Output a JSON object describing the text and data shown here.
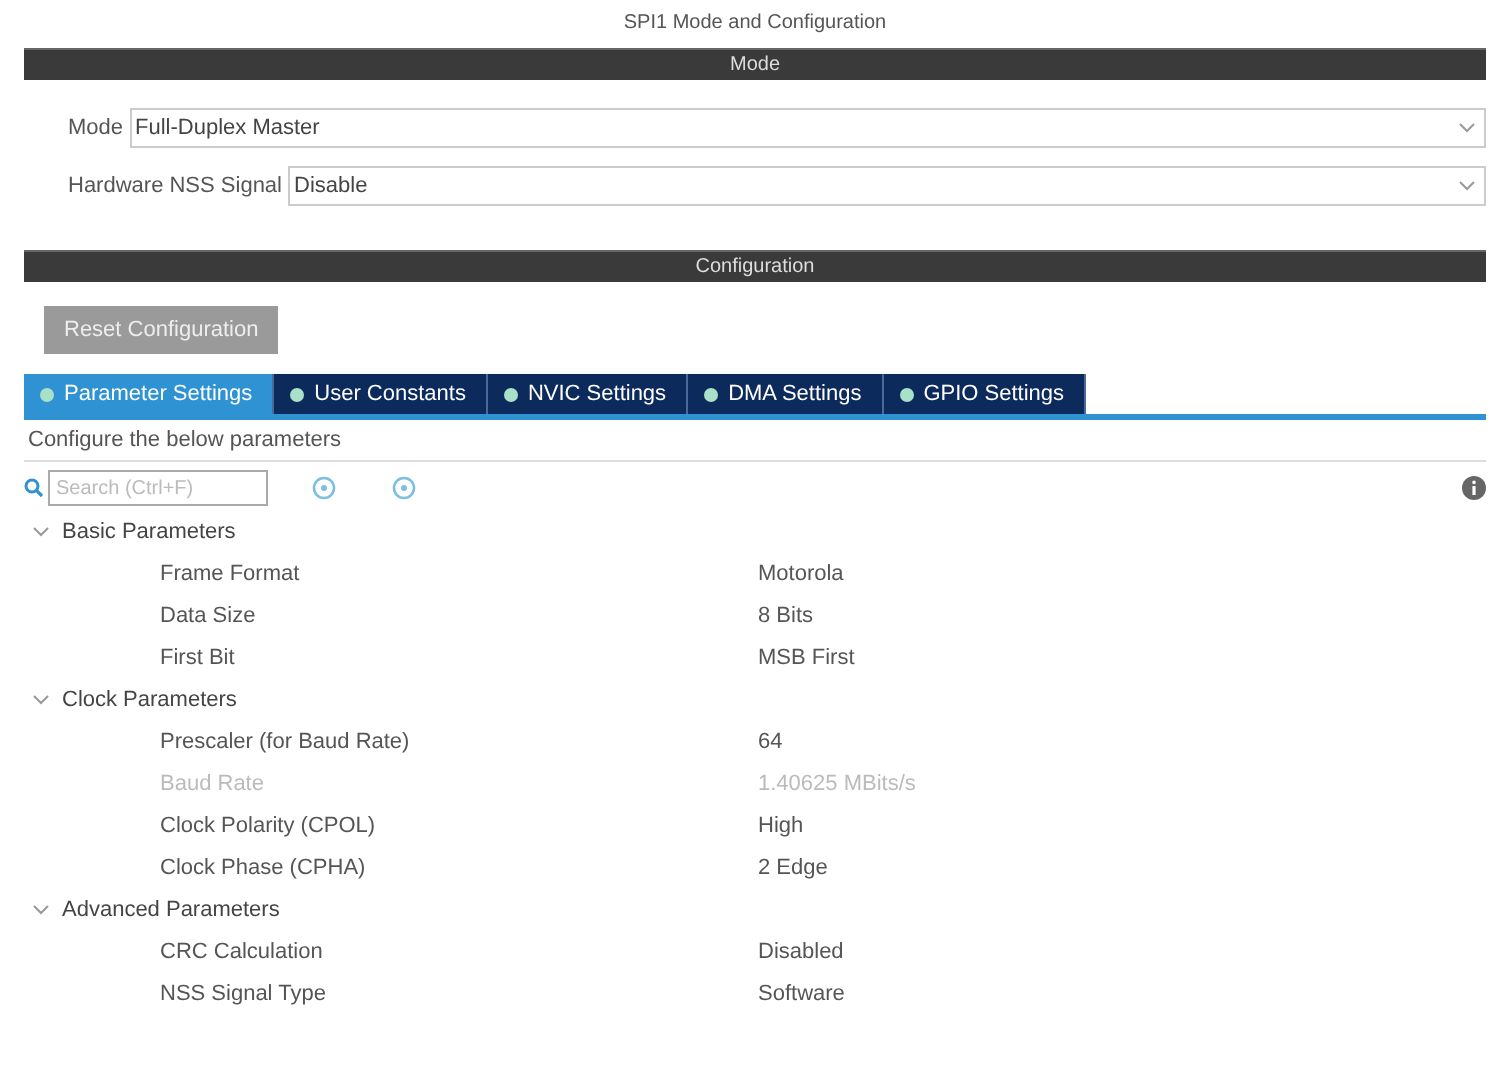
{
  "title": "SPI1 Mode and Configuration",
  "mode_section": {
    "header": "Mode",
    "fields": [
      {
        "label": "Mode",
        "value": "Full-Duplex Master"
      },
      {
        "label": "Hardware NSS Signal",
        "value": "Disable"
      }
    ]
  },
  "config_section": {
    "header": "Configuration",
    "reset_button": "Reset Configuration",
    "tabs": [
      {
        "label": "Parameter Settings",
        "selected": true
      },
      {
        "label": "User Constants",
        "selected": false
      },
      {
        "label": "NVIC Settings",
        "selected": false
      },
      {
        "label": "DMA Settings",
        "selected": false
      },
      {
        "label": "GPIO Settings",
        "selected": false
      }
    ],
    "hint": "Configure the below parameters",
    "search": {
      "placeholder": "Search (Ctrl+F)"
    },
    "groups": [
      {
        "name": "Basic Parameters",
        "expanded": true,
        "children": [
          {
            "name": "Frame Format",
            "value": "Motorola",
            "disabled": false
          },
          {
            "name": "Data Size",
            "value": "8 Bits",
            "disabled": false
          },
          {
            "name": "First Bit",
            "value": "MSB First",
            "disabled": false
          }
        ]
      },
      {
        "name": "Clock Parameters",
        "expanded": true,
        "children": [
          {
            "name": "Prescaler (for Baud Rate)",
            "value": "64",
            "disabled": false
          },
          {
            "name": "Baud Rate",
            "value": "1.40625 MBits/s",
            "disabled": true
          },
          {
            "name": "Clock Polarity (CPOL)",
            "value": "High",
            "disabled": false
          },
          {
            "name": "Clock Phase (CPHA)",
            "value": "2 Edge",
            "disabled": false
          }
        ]
      },
      {
        "name": "Advanced Parameters",
        "expanded": true,
        "children": [
          {
            "name": "CRC Calculation",
            "value": "Disabled",
            "disabled": false
          },
          {
            "name": "NSS Signal Type",
            "value": "Software",
            "disabled": false
          }
        ]
      }
    ]
  }
}
